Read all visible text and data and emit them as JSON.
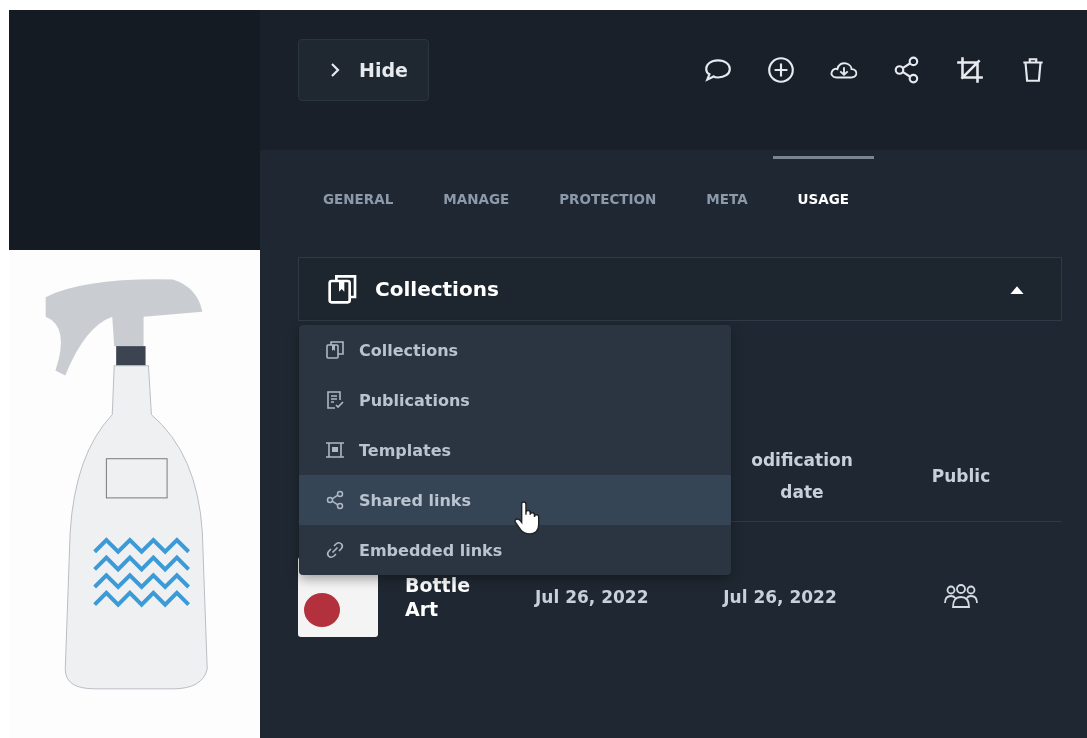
{
  "header": {
    "hide_button": {
      "label": "Hide"
    }
  },
  "tabs": [
    {
      "label": "GENERAL",
      "selected": false
    },
    {
      "label": "MANAGE",
      "selected": false
    },
    {
      "label": "PROTECTION",
      "selected": false
    },
    {
      "label": "META",
      "selected": false
    },
    {
      "label": "USAGE",
      "selected": true
    }
  ],
  "usage_select": {
    "value": "Collections",
    "expanded": true
  },
  "usage_menu": [
    {
      "kind": "collections",
      "label": "Collections",
      "hovered": false
    },
    {
      "kind": "publications",
      "label": "Publications",
      "hovered": false
    },
    {
      "kind": "templates",
      "label": "Templates",
      "hovered": false
    },
    {
      "kind": "shared",
      "label": "Shared links",
      "hovered": true
    },
    {
      "kind": "embedded",
      "label": "Embedded links",
      "hovered": false
    }
  ],
  "table": {
    "columns": [
      "odification date",
      "Public"
    ],
    "rows": [
      {
        "name": "Bottle Art",
        "created": "Jul 26, 2022",
        "modified": "Jul 26, 2022",
        "public": true
      }
    ]
  }
}
